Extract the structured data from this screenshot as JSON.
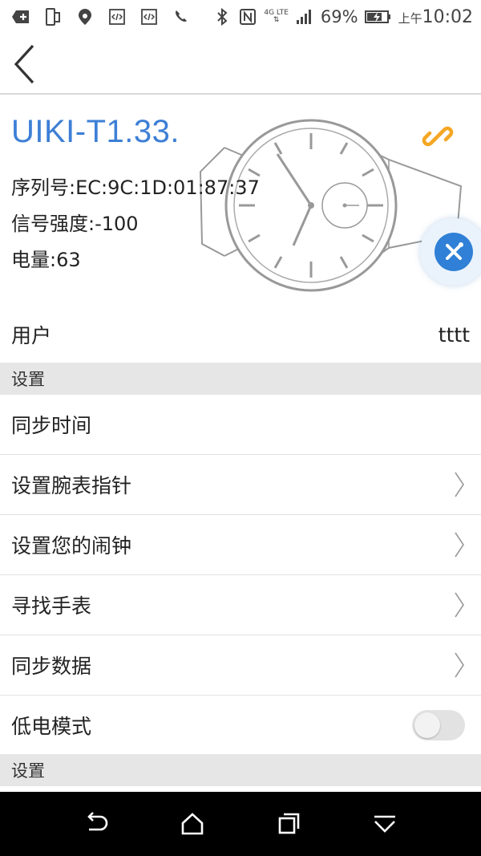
{
  "status_bar": {
    "battery_percent": "69%",
    "network": "4G LTE",
    "time_prefix": "上午",
    "time": "10:02",
    "icons": [
      "add-icon",
      "phone-screen-icon",
      "location-icon",
      "code-icon",
      "code-icon",
      "call-icon",
      "bluetooth-icon",
      "nfc-icon",
      "signal-icon",
      "battery-charging-icon"
    ]
  },
  "header": {
    "back_icon": "back-chevron-icon"
  },
  "device": {
    "name": "UIKI-T1.33.",
    "serial_label": "序列号:",
    "serial_value": "EC:9C:1D:01:87:37",
    "signal_label": "信号强度:",
    "signal_value": "-100",
    "battery_label": "电量:",
    "battery_value": "63"
  },
  "user_row": {
    "label": "用户",
    "value": "tttt"
  },
  "sections": [
    {
      "title": "设置"
    },
    {
      "title": "设置"
    }
  ],
  "settings": [
    {
      "label": "同步时间",
      "chevron": false
    },
    {
      "label": "设置腕表指针",
      "chevron": true
    },
    {
      "label": "设置您的闹钟",
      "chevron": true
    },
    {
      "label": "寻找手表",
      "chevron": true
    },
    {
      "label": "同步数据",
      "chevron": true
    }
  ],
  "low_power": {
    "label": "低电模式",
    "enabled": false
  },
  "colors": {
    "accent": "#3d7fd6",
    "link_icon": "#f5a623",
    "section_bg": "#e6e6e6"
  }
}
